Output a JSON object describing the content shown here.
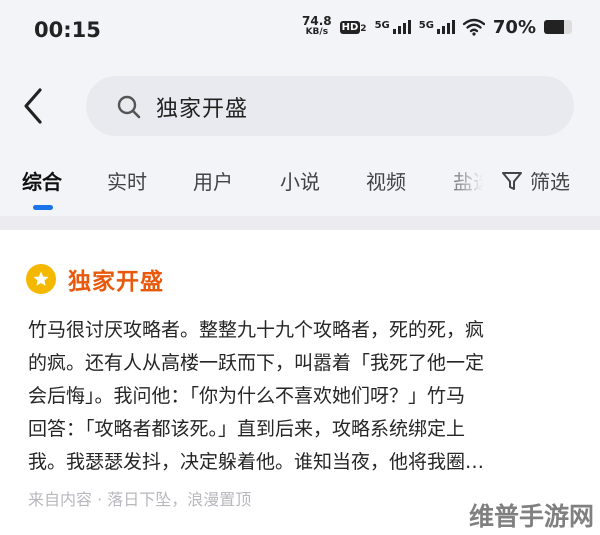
{
  "status_bar": {
    "time": "00:15",
    "net_speed_value": "74.8",
    "net_speed_unit": "KB/s",
    "hd_badge": "HD",
    "hd_sub": "2",
    "sim1_label": "5G",
    "sim2_label": "5G",
    "battery_percent": "70%",
    "battery_level": 0.7,
    "icons": [
      "wifi-icon",
      "battery-icon",
      "signal-icon"
    ]
  },
  "search": {
    "query": "独家开盛",
    "back_icon": "back-arrow-icon",
    "search_icon": "search-icon"
  },
  "tabs": {
    "items": [
      {
        "label": "综合",
        "active": true
      },
      {
        "label": "实时",
        "active": false
      },
      {
        "label": "用户",
        "active": false
      },
      {
        "label": "小说",
        "active": false
      },
      {
        "label": "视频",
        "active": false
      },
      {
        "label": "盐选",
        "active": false
      }
    ],
    "filter_label": "筛选",
    "accent": "#1a73e8"
  },
  "result": {
    "title": "独家开盛",
    "title_color": "#e8590c",
    "badge_color": "#f5b800",
    "snippet_lines": [
      "竹马很讨厌攻略者。整整九十九个攻略者，死的死，疯",
      "的疯。还有人从高楼一跃而下，叫嚣着「我死了他一定",
      "会后悔」。我问他：「你为什么不喜欢她们呀？」竹马",
      "回答：「攻略者都该死。」直到后来，攻略系统绑定上",
      "我。我瑟瑟发抖，决定躲着他。谁知当夜，他将我圈…"
    ],
    "meta": "来自内容 · 落日下坠，浪漫置顶"
  },
  "watermark": "维普手游网"
}
